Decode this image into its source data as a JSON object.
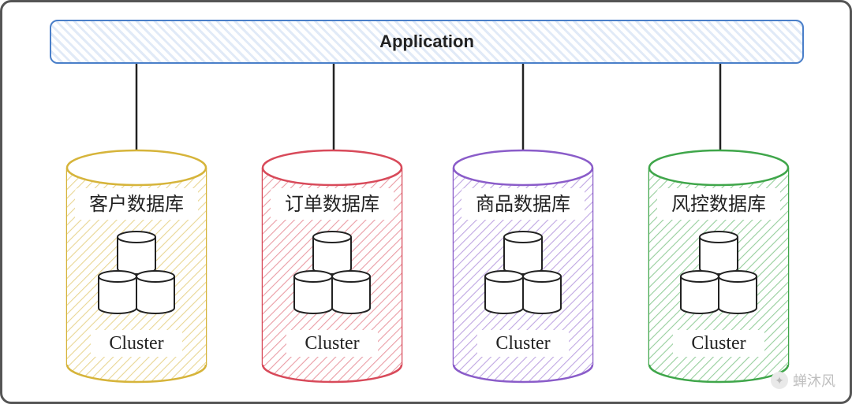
{
  "app": {
    "label": "Application"
  },
  "clusters": [
    {
      "title": "客户数据库",
      "sub": "Cluster",
      "color": "#d6b43a"
    },
    {
      "title": "订单数据库",
      "sub": "Cluster",
      "color": "#d84a5a"
    },
    {
      "title": "商品数据库",
      "sub": "Cluster",
      "color": "#8a5cc9"
    },
    {
      "title": "风控数据库",
      "sub": "Cluster",
      "color": "#3fa64a"
    }
  ],
  "watermark": "蝉沐风"
}
